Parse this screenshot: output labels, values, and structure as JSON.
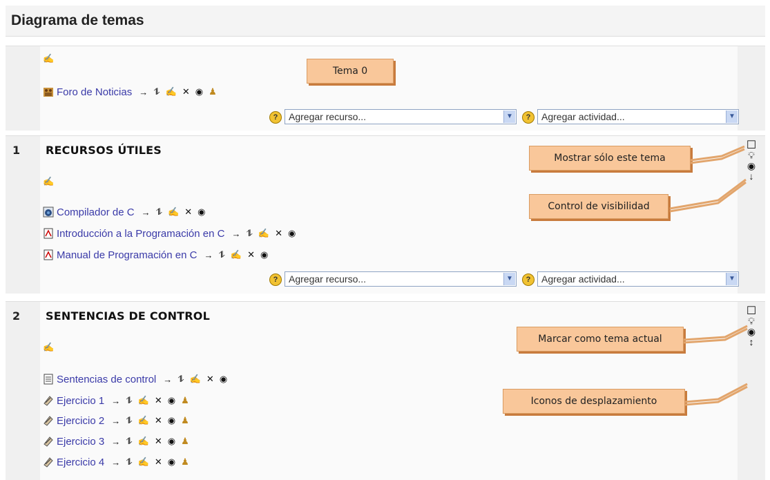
{
  "page": {
    "title": "Diagrama de temas"
  },
  "callouts": {
    "tema0": "Tema 0",
    "mostrar": "Mostrar sólo este tema",
    "visibilidad": "Control de visibilidad",
    "marcar": "Marcar como tema actual",
    "desplazamiento": "Iconos de desplazamiento"
  },
  "selects": {
    "recurso": "Agregar recurso...",
    "actividad": "Agregar actividad..."
  },
  "tools": {
    "move": "→",
    "move_vert": "⥮",
    "edit": "✍",
    "delete": "✕",
    "eye": "◉",
    "person": "♟"
  },
  "section0": {
    "activities": [
      {
        "label": "Foro de Noticias",
        "icon": "forum-icon"
      }
    ]
  },
  "section1": {
    "number": "1",
    "title": "RECURSOS ÚTILES",
    "activities": [
      {
        "label": "Compilador de C",
        "icon": "web-link-icon"
      },
      {
        "label": "Introducción a la Programación en C",
        "icon": "pdf-icon"
      },
      {
        "label": "Manual de Programación en C",
        "icon": "pdf-icon"
      }
    ]
  },
  "section2": {
    "number": "2",
    "title": "SENTENCIAS DE CONTROL",
    "activities": [
      {
        "label": "Sentencias de control",
        "icon": "page-icon"
      },
      {
        "label": "Ejercicio 1",
        "icon": "assignment-icon"
      },
      {
        "label": "Ejercicio 2",
        "icon": "assignment-icon"
      },
      {
        "label": "Ejercicio 3",
        "icon": "assignment-icon"
      },
      {
        "label": "Ejercicio 4",
        "icon": "assignment-icon"
      }
    ]
  }
}
